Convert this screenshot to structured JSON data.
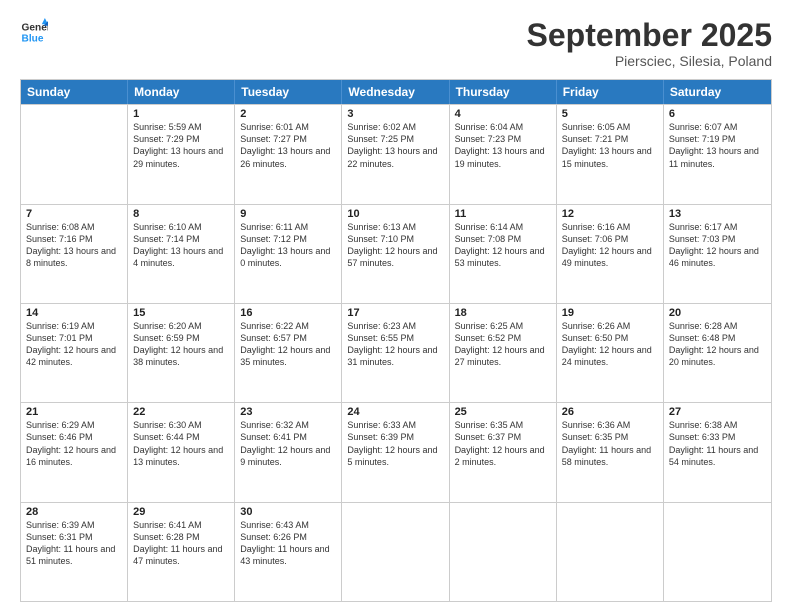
{
  "header": {
    "logo_line1": "General",
    "logo_line2": "Blue",
    "month": "September 2025",
    "location": "Piersciec, Silesia, Poland"
  },
  "weekdays": [
    "Sunday",
    "Monday",
    "Tuesday",
    "Wednesday",
    "Thursday",
    "Friday",
    "Saturday"
  ],
  "weeks": [
    [
      {
        "day": "",
        "sunrise": "",
        "sunset": "",
        "daylight": ""
      },
      {
        "day": "1",
        "sunrise": "Sunrise: 5:59 AM",
        "sunset": "Sunset: 7:29 PM",
        "daylight": "Daylight: 13 hours and 29 minutes."
      },
      {
        "day": "2",
        "sunrise": "Sunrise: 6:01 AM",
        "sunset": "Sunset: 7:27 PM",
        "daylight": "Daylight: 13 hours and 26 minutes."
      },
      {
        "day": "3",
        "sunrise": "Sunrise: 6:02 AM",
        "sunset": "Sunset: 7:25 PM",
        "daylight": "Daylight: 13 hours and 22 minutes."
      },
      {
        "day": "4",
        "sunrise": "Sunrise: 6:04 AM",
        "sunset": "Sunset: 7:23 PM",
        "daylight": "Daylight: 13 hours and 19 minutes."
      },
      {
        "day": "5",
        "sunrise": "Sunrise: 6:05 AM",
        "sunset": "Sunset: 7:21 PM",
        "daylight": "Daylight: 13 hours and 15 minutes."
      },
      {
        "day": "6",
        "sunrise": "Sunrise: 6:07 AM",
        "sunset": "Sunset: 7:19 PM",
        "daylight": "Daylight: 13 hours and 11 minutes."
      }
    ],
    [
      {
        "day": "7",
        "sunrise": "Sunrise: 6:08 AM",
        "sunset": "Sunset: 7:16 PM",
        "daylight": "Daylight: 13 hours and 8 minutes."
      },
      {
        "day": "8",
        "sunrise": "Sunrise: 6:10 AM",
        "sunset": "Sunset: 7:14 PM",
        "daylight": "Daylight: 13 hours and 4 minutes."
      },
      {
        "day": "9",
        "sunrise": "Sunrise: 6:11 AM",
        "sunset": "Sunset: 7:12 PM",
        "daylight": "Daylight: 13 hours and 0 minutes."
      },
      {
        "day": "10",
        "sunrise": "Sunrise: 6:13 AM",
        "sunset": "Sunset: 7:10 PM",
        "daylight": "Daylight: 12 hours and 57 minutes."
      },
      {
        "day": "11",
        "sunrise": "Sunrise: 6:14 AM",
        "sunset": "Sunset: 7:08 PM",
        "daylight": "Daylight: 12 hours and 53 minutes."
      },
      {
        "day": "12",
        "sunrise": "Sunrise: 6:16 AM",
        "sunset": "Sunset: 7:06 PM",
        "daylight": "Daylight: 12 hours and 49 minutes."
      },
      {
        "day": "13",
        "sunrise": "Sunrise: 6:17 AM",
        "sunset": "Sunset: 7:03 PM",
        "daylight": "Daylight: 12 hours and 46 minutes."
      }
    ],
    [
      {
        "day": "14",
        "sunrise": "Sunrise: 6:19 AM",
        "sunset": "Sunset: 7:01 PM",
        "daylight": "Daylight: 12 hours and 42 minutes."
      },
      {
        "day": "15",
        "sunrise": "Sunrise: 6:20 AM",
        "sunset": "Sunset: 6:59 PM",
        "daylight": "Daylight: 12 hours and 38 minutes."
      },
      {
        "day": "16",
        "sunrise": "Sunrise: 6:22 AM",
        "sunset": "Sunset: 6:57 PM",
        "daylight": "Daylight: 12 hours and 35 minutes."
      },
      {
        "day": "17",
        "sunrise": "Sunrise: 6:23 AM",
        "sunset": "Sunset: 6:55 PM",
        "daylight": "Daylight: 12 hours and 31 minutes."
      },
      {
        "day": "18",
        "sunrise": "Sunrise: 6:25 AM",
        "sunset": "Sunset: 6:52 PM",
        "daylight": "Daylight: 12 hours and 27 minutes."
      },
      {
        "day": "19",
        "sunrise": "Sunrise: 6:26 AM",
        "sunset": "Sunset: 6:50 PM",
        "daylight": "Daylight: 12 hours and 24 minutes."
      },
      {
        "day": "20",
        "sunrise": "Sunrise: 6:28 AM",
        "sunset": "Sunset: 6:48 PM",
        "daylight": "Daylight: 12 hours and 20 minutes."
      }
    ],
    [
      {
        "day": "21",
        "sunrise": "Sunrise: 6:29 AM",
        "sunset": "Sunset: 6:46 PM",
        "daylight": "Daylight: 12 hours and 16 minutes."
      },
      {
        "day": "22",
        "sunrise": "Sunrise: 6:30 AM",
        "sunset": "Sunset: 6:44 PM",
        "daylight": "Daylight: 12 hours and 13 minutes."
      },
      {
        "day": "23",
        "sunrise": "Sunrise: 6:32 AM",
        "sunset": "Sunset: 6:41 PM",
        "daylight": "Daylight: 12 hours and 9 minutes."
      },
      {
        "day": "24",
        "sunrise": "Sunrise: 6:33 AM",
        "sunset": "Sunset: 6:39 PM",
        "daylight": "Daylight: 12 hours and 5 minutes."
      },
      {
        "day": "25",
        "sunrise": "Sunrise: 6:35 AM",
        "sunset": "Sunset: 6:37 PM",
        "daylight": "Daylight: 12 hours and 2 minutes."
      },
      {
        "day": "26",
        "sunrise": "Sunrise: 6:36 AM",
        "sunset": "Sunset: 6:35 PM",
        "daylight": "Daylight: 11 hours and 58 minutes."
      },
      {
        "day": "27",
        "sunrise": "Sunrise: 6:38 AM",
        "sunset": "Sunset: 6:33 PM",
        "daylight": "Daylight: 11 hours and 54 minutes."
      }
    ],
    [
      {
        "day": "28",
        "sunrise": "Sunrise: 6:39 AM",
        "sunset": "Sunset: 6:31 PM",
        "daylight": "Daylight: 11 hours and 51 minutes."
      },
      {
        "day": "29",
        "sunrise": "Sunrise: 6:41 AM",
        "sunset": "Sunset: 6:28 PM",
        "daylight": "Daylight: 11 hours and 47 minutes."
      },
      {
        "day": "30",
        "sunrise": "Sunrise: 6:43 AM",
        "sunset": "Sunset: 6:26 PM",
        "daylight": "Daylight: 11 hours and 43 minutes."
      },
      {
        "day": "",
        "sunrise": "",
        "sunset": "",
        "daylight": ""
      },
      {
        "day": "",
        "sunrise": "",
        "sunset": "",
        "daylight": ""
      },
      {
        "day": "",
        "sunrise": "",
        "sunset": "",
        "daylight": ""
      },
      {
        "day": "",
        "sunrise": "",
        "sunset": "",
        "daylight": ""
      }
    ]
  ]
}
